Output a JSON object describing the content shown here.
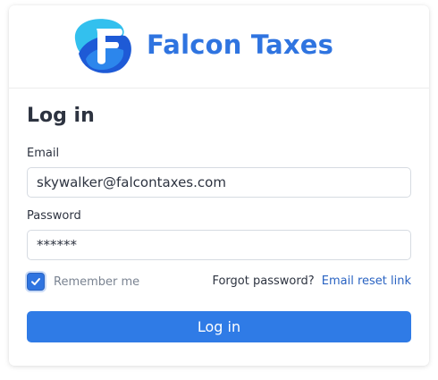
{
  "brand": {
    "name": "Falcon Taxes",
    "logo_icon": "falcon-f-logo",
    "color": "#2f74e0"
  },
  "form": {
    "heading": "Log in",
    "email_label": "Email",
    "email_value": "skywalker@falcontaxes.com",
    "password_label": "Password",
    "password_value": "******",
    "remember_label": "Remember me",
    "remember_checked": true,
    "forgot_text": "Forgot password?",
    "reset_link": "Email reset link",
    "submit_label": "Log in"
  },
  "colors": {
    "accent": "#2f7be6",
    "link": "#2a63c2",
    "muted_text": "#7a8391"
  },
  "icons": {
    "checkbox": "checkmark-icon"
  }
}
